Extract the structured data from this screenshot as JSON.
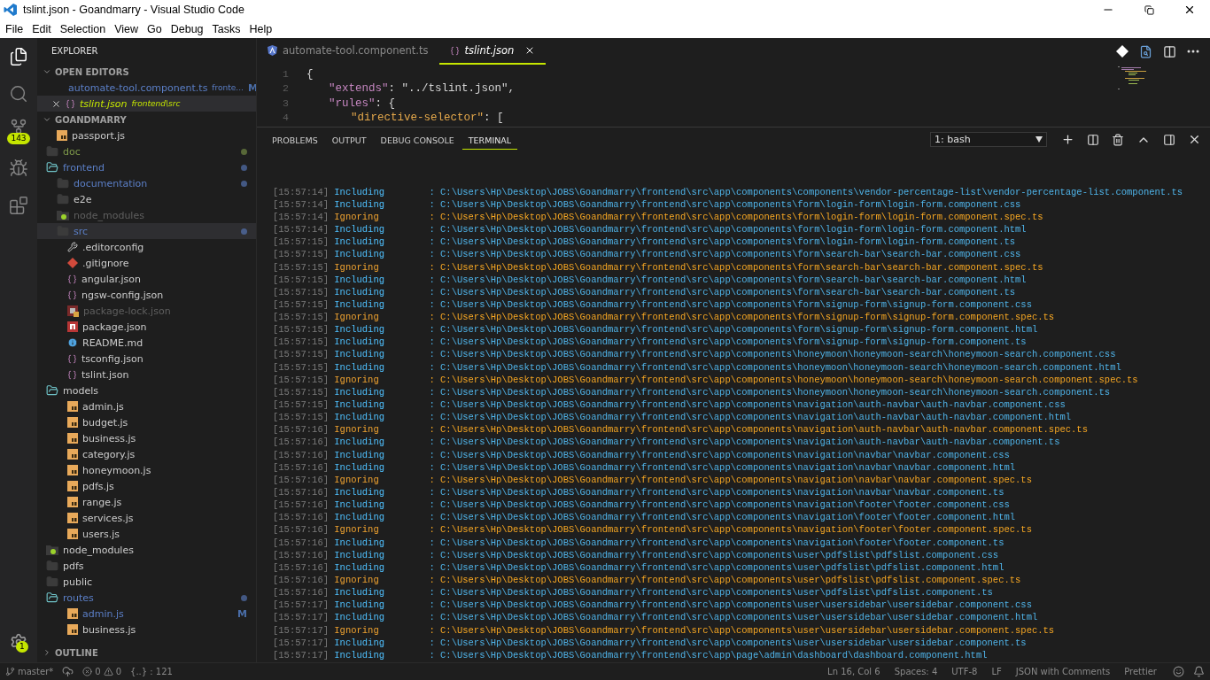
{
  "window": {
    "title": "tslint.json - Goandmarry - Visual Studio Code"
  },
  "menu": [
    "File",
    "Edit",
    "Selection",
    "View",
    "Go",
    "Debug",
    "Tasks",
    "Help"
  ],
  "activity_bar": {
    "items": [
      {
        "kind": "explorer",
        "selected": true
      },
      {
        "kind": "search",
        "selected": false
      },
      {
        "kind": "scm",
        "selected": false,
        "badge": "143"
      },
      {
        "kind": "debug",
        "selected": false
      },
      {
        "kind": "extensions",
        "selected": false
      }
    ],
    "settings_badge": "1"
  },
  "sidebar": {
    "title": "EXPLORER",
    "open_editors": {
      "title": "OPEN EDITORS",
      "expanded": true,
      "items": [
        {
          "name": "automate-tool.component.ts",
          "path": "fronte...",
          "kind": "angular",
          "color": "#5b7fc7",
          "badge": "M",
          "selected": false
        },
        {
          "name": "tslint.json",
          "path": "frontend\\src",
          "kind": "json",
          "color": "#c5e600",
          "selected": true
        }
      ]
    },
    "folder": {
      "title": "GOANDMARRY",
      "expanded": true,
      "tree": [
        {
          "name": "passport.js",
          "kind": "js",
          "color": "#cccccc",
          "dot": false,
          "selected": false
        },
        {
          "name": "doc",
          "kind": "folder",
          "expanded": false,
          "color": "#7f9a4a",
          "dot": true,
          "selected": false
        },
        {
          "name": "frontend",
          "kind": "folder",
          "expanded": true,
          "color": "#5b7fc7",
          "dot": true,
          "selected": false,
          "children": [
            {
              "name": "documentation",
              "kind": "folder",
              "expanded": false,
              "color": "#5b7fc7",
              "dot": true,
              "selected": false
            },
            {
              "name": "e2e",
              "kind": "folder",
              "expanded": false,
              "color": "#cccccc",
              "dot": false,
              "selected": false
            },
            {
              "name": "node_modules",
              "kind": "linked-folder",
              "expanded": false,
              "color": "#5f5f5f",
              "dot": false,
              "selected": false
            },
            {
              "name": "src",
              "kind": "folder",
              "expanded": false,
              "color": "#5b7fc7",
              "dot": true,
              "selected": true
            },
            {
              "name": ".editorconfig",
              "kind": "tools",
              "color": "#cccccc",
              "dot": false,
              "selected": false
            },
            {
              "name": ".gitignore",
              "kind": "git",
              "color": "#cccccc",
              "dot": false,
              "selected": false
            },
            {
              "name": "angular.json",
              "kind": "json",
              "color": "#cccccc",
              "dot": false,
              "selected": false
            },
            {
              "name": "ngsw-config.json",
              "kind": "json",
              "color": "#cccccc",
              "dot": false,
              "selected": false
            },
            {
              "name": "package-lock.json",
              "kind": "locked-npm",
              "color": "#5f5f5f",
              "dot": false,
              "selected": false
            },
            {
              "name": "package.json",
              "kind": "npm",
              "color": "#cccccc",
              "dot": false,
              "selected": false
            },
            {
              "name": "README.md",
              "kind": "info",
              "color": "#cccccc",
              "dot": false,
              "selected": false
            },
            {
              "name": "tsconfig.json",
              "kind": "json",
              "color": "#cccccc",
              "dot": false,
              "selected": false
            },
            {
              "name": "tslint.json",
              "kind": "json",
              "color": "#cccccc",
              "dot": false,
              "selected": false
            }
          ]
        },
        {
          "name": "models",
          "kind": "folder",
          "expanded": true,
          "color": "#cccccc",
          "dot": false,
          "selected": false,
          "children": [
            {
              "name": "admin.js",
              "kind": "js",
              "color": "#cccccc",
              "dot": false,
              "selected": false
            },
            {
              "name": "budget.js",
              "kind": "js",
              "color": "#cccccc",
              "dot": false,
              "selected": false
            },
            {
              "name": "business.js",
              "kind": "js",
              "color": "#cccccc",
              "dot": false,
              "selected": false
            },
            {
              "name": "category.js",
              "kind": "js",
              "color": "#cccccc",
              "dot": false,
              "selected": false
            },
            {
              "name": "honeymoon.js",
              "kind": "js",
              "color": "#cccccc",
              "dot": false,
              "selected": false
            },
            {
              "name": "pdfs.js",
              "kind": "js",
              "color": "#cccccc",
              "dot": false,
              "selected": false
            },
            {
              "name": "range.js",
              "kind": "js",
              "color": "#cccccc",
              "dot": false,
              "selected": false
            },
            {
              "name": "services.js",
              "kind": "js",
              "color": "#cccccc",
              "dot": false,
              "selected": false
            },
            {
              "name": "users.js",
              "kind": "js",
              "color": "#cccccc",
              "dot": false,
              "selected": false
            }
          ]
        },
        {
          "name": "node_modules",
          "kind": "linked-folder",
          "expanded": false,
          "color": "#cccccc",
          "dot": false,
          "selected": false
        },
        {
          "name": "pdfs",
          "kind": "folder",
          "expanded": false,
          "color": "#cccccc",
          "dot": false,
          "selected": false
        },
        {
          "name": "public",
          "kind": "folder",
          "expanded": false,
          "color": "#cccccc",
          "dot": false,
          "selected": false
        },
        {
          "name": "routes",
          "kind": "folder",
          "expanded": true,
          "color": "#5b7fc7",
          "dot": true,
          "selected": false,
          "children": [
            {
              "name": "admin.js",
              "kind": "js",
              "color": "#5b7fc7",
              "dot": false,
              "badge": "M",
              "selected": false
            },
            {
              "name": "business.js",
              "kind": "js",
              "color": "#cccccc",
              "dot": false,
              "selected": false
            }
          ]
        }
      ]
    },
    "outline": {
      "title": "OUTLINE",
      "expanded": false
    }
  },
  "editor": {
    "tabs": [
      {
        "label": "automate-tool.component.ts",
        "kind": "angular",
        "selected": false,
        "preview": false
      },
      {
        "label": "tslint.json",
        "kind": "json",
        "selected": true,
        "preview": true
      }
    ],
    "lines": [
      {
        "number": "1",
        "tokens": [
          {
            "kind": "punct",
            "text": "{"
          }
        ]
      },
      {
        "number": "2",
        "tokens": [
          {
            "kind": "key",
            "text": "\"extends\""
          },
          {
            "kind": "punct",
            "text": ": "
          },
          {
            "kind": "string",
            "text": "\"../tslint.json\""
          },
          {
            "kind": "punct",
            "text": ","
          }
        ]
      },
      {
        "number": "3",
        "tokens": [
          {
            "kind": "key",
            "text": "\"rules\""
          },
          {
            "kind": "punct",
            "text": ": "
          },
          {
            "kind": "bracket",
            "text": "{"
          }
        ]
      },
      {
        "number": "4",
        "tokens": [
          {
            "kind": "key2",
            "text": "\"directive-selector\""
          },
          {
            "kind": "punct",
            "text": ": "
          },
          {
            "kind": "array",
            "text": "["
          }
        ]
      }
    ]
  },
  "panel": {
    "tabs": [
      {
        "label": "PROBLEMS",
        "selected": false
      },
      {
        "label": "OUTPUT",
        "selected": false
      },
      {
        "label": "DEBUG CONSOLE",
        "selected": false
      },
      {
        "label": "TERMINAL",
        "selected": true
      }
    ],
    "terminal_select": "1: bash",
    "lines": [
      {
        "time": "[15:57:14]",
        "kind": "include",
        "action": "Including",
        "path": ": C:\\Users\\Hp\\Desktop\\JOBS\\Goandmarry\\frontend\\src\\app\\components\\components\\vendor-percentage-list\\vendor-percentage-list.component.ts"
      },
      {
        "time": "[15:57:14]",
        "kind": "include",
        "action": "Including",
        "path": ": C:\\Users\\Hp\\Desktop\\JOBS\\Goandmarry\\frontend\\src\\app\\components\\form\\login-form\\login-form.component.css"
      },
      {
        "time": "[15:57:14]",
        "kind": "ignore",
        "action": "Ignoring",
        "path": ": C:\\Users\\Hp\\Desktop\\JOBS\\Goandmarry\\frontend\\src\\app\\components\\form\\login-form\\login-form.component.spec.ts"
      },
      {
        "time": "[15:57:14]",
        "kind": "include",
        "action": "Including",
        "path": ": C:\\Users\\Hp\\Desktop\\JOBS\\Goandmarry\\frontend\\src\\app\\components\\form\\login-form\\login-form.component.html"
      },
      {
        "time": "[15:57:15]",
        "kind": "include",
        "action": "Including",
        "path": ": C:\\Users\\Hp\\Desktop\\JOBS\\Goandmarry\\frontend\\src\\app\\components\\form\\login-form\\login-form.component.ts"
      },
      {
        "time": "[15:57:15]",
        "kind": "include",
        "action": "Including",
        "path": ": C:\\Users\\Hp\\Desktop\\JOBS\\Goandmarry\\frontend\\src\\app\\components\\form\\search-bar\\search-bar.component.css"
      },
      {
        "time": "[15:57:15]",
        "kind": "ignore",
        "action": "Ignoring",
        "path": ": C:\\Users\\Hp\\Desktop\\JOBS\\Goandmarry\\frontend\\src\\app\\components\\form\\search-bar\\search-bar.component.spec.ts"
      },
      {
        "time": "[15:57:15]",
        "kind": "include",
        "action": "Including",
        "path": ": C:\\Users\\Hp\\Desktop\\JOBS\\Goandmarry\\frontend\\src\\app\\components\\form\\search-bar\\search-bar.component.html"
      },
      {
        "time": "[15:57:15]",
        "kind": "include",
        "action": "Including",
        "path": ": C:\\Users\\Hp\\Desktop\\JOBS\\Goandmarry\\frontend\\src\\app\\components\\form\\search-bar\\search-bar.component.ts"
      },
      {
        "time": "[15:57:15]",
        "kind": "include",
        "action": "Including",
        "path": ": C:\\Users\\Hp\\Desktop\\JOBS\\Goandmarry\\frontend\\src\\app\\components\\form\\signup-form\\signup-form.component.css"
      },
      {
        "time": "[15:57:15]",
        "kind": "ignore",
        "action": "Ignoring",
        "path": ": C:\\Users\\Hp\\Desktop\\JOBS\\Goandmarry\\frontend\\src\\app\\components\\form\\signup-form\\signup-form.component.spec.ts"
      },
      {
        "time": "[15:57:15]",
        "kind": "include",
        "action": "Including",
        "path": ": C:\\Users\\Hp\\Desktop\\JOBS\\Goandmarry\\frontend\\src\\app\\components\\form\\signup-form\\signup-form.component.html"
      },
      {
        "time": "[15:57:15]",
        "kind": "include",
        "action": "Including",
        "path": ": C:\\Users\\Hp\\Desktop\\JOBS\\Goandmarry\\frontend\\src\\app\\components\\form\\signup-form\\signup-form.component.ts"
      },
      {
        "time": "[15:57:15]",
        "kind": "include",
        "action": "Including",
        "path": ": C:\\Users\\Hp\\Desktop\\JOBS\\Goandmarry\\frontend\\src\\app\\components\\honeymoon\\honeymoon-search\\honeymoon-search.component.css"
      },
      {
        "time": "[15:57:15]",
        "kind": "include",
        "action": "Including",
        "path": ": C:\\Users\\Hp\\Desktop\\JOBS\\Goandmarry\\frontend\\src\\app\\components\\honeymoon\\honeymoon-search\\honeymoon-search.component.html"
      },
      {
        "time": "[15:57:15]",
        "kind": "ignore",
        "action": "Ignoring",
        "path": ": C:\\Users\\Hp\\Desktop\\JOBS\\Goandmarry\\frontend\\src\\app\\components\\honeymoon\\honeymoon-search\\honeymoon-search.component.spec.ts"
      },
      {
        "time": "[15:57:15]",
        "kind": "include",
        "action": "Including",
        "path": ": C:\\Users\\Hp\\Desktop\\JOBS\\Goandmarry\\frontend\\src\\app\\components\\honeymoon\\honeymoon-search\\honeymoon-search.component.ts"
      },
      {
        "time": "[15:57:15]",
        "kind": "include",
        "action": "Including",
        "path": ": C:\\Users\\Hp\\Desktop\\JOBS\\Goandmarry\\frontend\\src\\app\\components\\navigation\\auth-navbar\\auth-navbar.component.css"
      },
      {
        "time": "[15:57:15]",
        "kind": "include",
        "action": "Including",
        "path": ": C:\\Users\\Hp\\Desktop\\JOBS\\Goandmarry\\frontend\\src\\app\\components\\navigation\\auth-navbar\\auth-navbar.component.html"
      },
      {
        "time": "[15:57:16]",
        "kind": "ignore",
        "action": "Ignoring",
        "path": ": C:\\Users\\Hp\\Desktop\\JOBS\\Goandmarry\\frontend\\src\\app\\components\\navigation\\auth-navbar\\auth-navbar.component.spec.ts"
      },
      {
        "time": "[15:57:16]",
        "kind": "include",
        "action": "Including",
        "path": ": C:\\Users\\Hp\\Desktop\\JOBS\\Goandmarry\\frontend\\src\\app\\components\\navigation\\auth-navbar\\auth-navbar.component.ts"
      },
      {
        "time": "[15:57:16]",
        "kind": "include",
        "action": "Including",
        "path": ": C:\\Users\\Hp\\Desktop\\JOBS\\Goandmarry\\frontend\\src\\app\\components\\navigation\\navbar\\navbar.component.css"
      },
      {
        "time": "[15:57:16]",
        "kind": "include",
        "action": "Including",
        "path": ": C:\\Users\\Hp\\Desktop\\JOBS\\Goandmarry\\frontend\\src\\app\\components\\navigation\\navbar\\navbar.component.html"
      },
      {
        "time": "[15:57:16]",
        "kind": "ignore",
        "action": "Ignoring",
        "path": ": C:\\Users\\Hp\\Desktop\\JOBS\\Goandmarry\\frontend\\src\\app\\components\\navigation\\navbar\\navbar.component.spec.ts"
      },
      {
        "time": "[15:57:16]",
        "kind": "include",
        "action": "Including",
        "path": ": C:\\Users\\Hp\\Desktop\\JOBS\\Goandmarry\\frontend\\src\\app\\components\\navigation\\navbar\\navbar.component.ts"
      },
      {
        "time": "[15:57:16]",
        "kind": "include",
        "action": "Including",
        "path": ": C:\\Users\\Hp\\Desktop\\JOBS\\Goandmarry\\frontend\\src\\app\\components\\navigation\\footer\\footer.component.css"
      },
      {
        "time": "[15:57:16]",
        "kind": "include",
        "action": "Including",
        "path": ": C:\\Users\\Hp\\Desktop\\JOBS\\Goandmarry\\frontend\\src\\app\\components\\navigation\\footer\\footer.component.html"
      },
      {
        "time": "[15:57:16]",
        "kind": "ignore",
        "action": "Ignoring",
        "path": ": C:\\Users\\Hp\\Desktop\\JOBS\\Goandmarry\\frontend\\src\\app\\components\\navigation\\footer\\footer.component.spec.ts"
      },
      {
        "time": "[15:57:16]",
        "kind": "include",
        "action": "Including",
        "path": ": C:\\Users\\Hp\\Desktop\\JOBS\\Goandmarry\\frontend\\src\\app\\components\\navigation\\footer\\footer.component.ts"
      },
      {
        "time": "[15:57:16]",
        "kind": "include",
        "action": "Including",
        "path": ": C:\\Users\\Hp\\Desktop\\JOBS\\Goandmarry\\frontend\\src\\app\\components\\user\\pdfslist\\pdfslist.component.css"
      },
      {
        "time": "[15:57:16]",
        "kind": "include",
        "action": "Including",
        "path": ": C:\\Users\\Hp\\Desktop\\JOBS\\Goandmarry\\frontend\\src\\app\\components\\user\\pdfslist\\pdfslist.component.html"
      },
      {
        "time": "[15:57:16]",
        "kind": "ignore",
        "action": "Ignoring",
        "path": ": C:\\Users\\Hp\\Desktop\\JOBS\\Goandmarry\\frontend\\src\\app\\components\\user\\pdfslist\\pdfslist.component.spec.ts"
      },
      {
        "time": "[15:57:16]",
        "kind": "include",
        "action": "Including",
        "path": ": C:\\Users\\Hp\\Desktop\\JOBS\\Goandmarry\\frontend\\src\\app\\components\\user\\pdfslist\\pdfslist.component.ts"
      },
      {
        "time": "[15:57:17]",
        "kind": "include",
        "action": "Including",
        "path": ": C:\\Users\\Hp\\Desktop\\JOBS\\Goandmarry\\frontend\\src\\app\\components\\user\\usersidebar\\usersidebar.component.css"
      },
      {
        "time": "[15:57:17]",
        "kind": "include",
        "action": "Including",
        "path": ": C:\\Users\\Hp\\Desktop\\JOBS\\Goandmarry\\frontend\\src\\app\\components\\user\\usersidebar\\usersidebar.component.html"
      },
      {
        "time": "[15:57:17]",
        "kind": "ignore",
        "action": "Ignoring",
        "path": ": C:\\Users\\Hp\\Desktop\\JOBS\\Goandmarry\\frontend\\src\\app\\components\\user\\usersidebar\\usersidebar.component.spec.ts"
      },
      {
        "time": "[15:57:17]",
        "kind": "include",
        "action": "Including",
        "path": ": C:\\Users\\Hp\\Desktop\\JOBS\\Goandmarry\\frontend\\src\\app\\components\\user\\usersidebar\\usersidebar.component.ts"
      },
      {
        "time": "[15:57:17]",
        "kind": "include",
        "action": "Including",
        "path": ": C:\\Users\\Hp\\Desktop\\JOBS\\Goandmarry\\frontend\\src\\app\\page\\admin\\dashboard\\dashboard.component.html"
      }
    ]
  },
  "status_bar": {
    "branch": "master*",
    "errors": "0",
    "warnings": "0",
    "info": "{..} : 121",
    "right": [
      "Ln 16, Col 6",
      "Spaces: 4",
      "UTF-8",
      "LF",
      "JSON with Comments",
      "Prettier"
    ]
  }
}
